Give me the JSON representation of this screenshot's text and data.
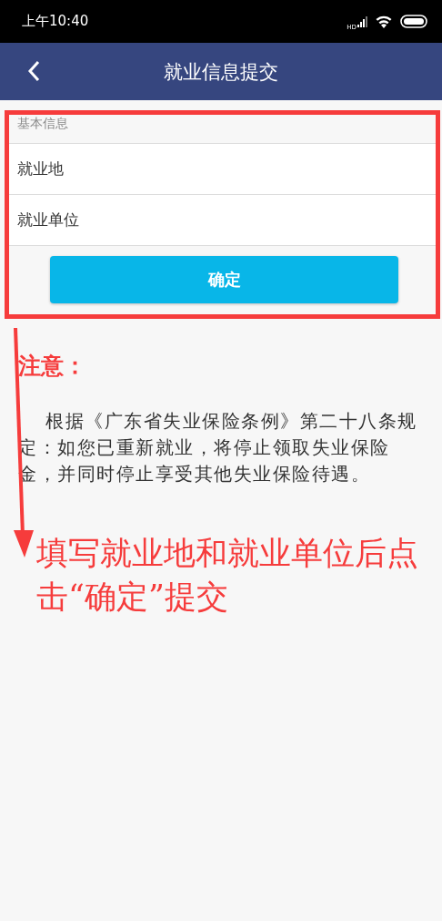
{
  "status_bar": {
    "time": "上午10:40",
    "network": "HD"
  },
  "nav": {
    "title": "就业信息提交"
  },
  "form": {
    "section_title": "基本信息",
    "fields": [
      {
        "label": "就业地"
      },
      {
        "label": "就业单位"
      }
    ],
    "button": "确定"
  },
  "notice": {
    "text": "根据《广东省失业保险条例》第二十八条规定：如您已重新就业，将停止领取失业保险金，并同时停止享受其他失业保险待遇。"
  },
  "annotation": {
    "heading": "注意：",
    "callout": "填写就业地和就业单位后点击“确定”提交"
  }
}
